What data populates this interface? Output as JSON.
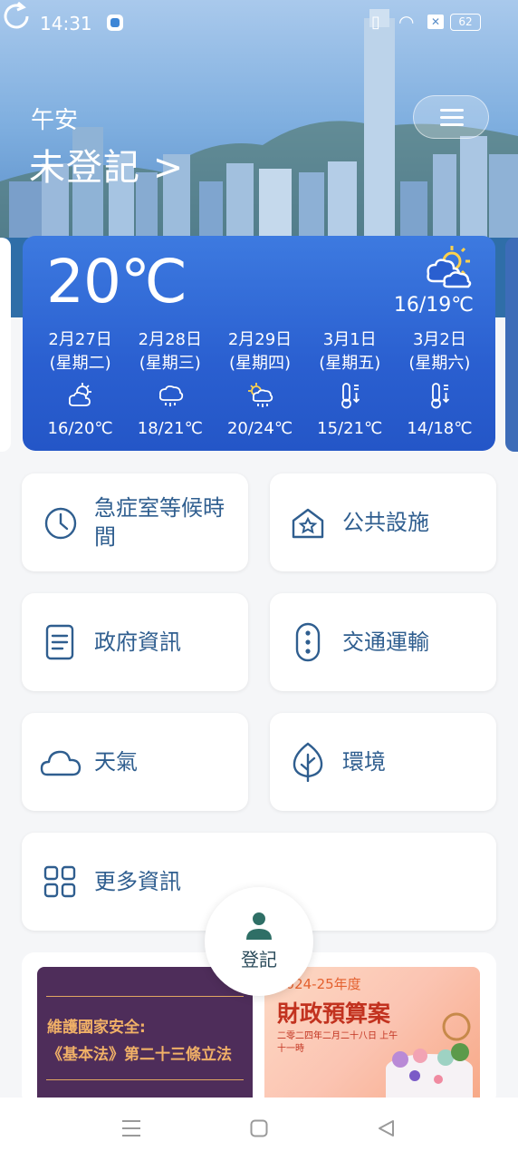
{
  "status": {
    "time": "14:31",
    "battery": "62"
  },
  "header": {
    "greeting": "午安",
    "login_link": "未登記 >"
  },
  "weather": {
    "current_temp": "20℃",
    "today_range": "16/19℃",
    "forecast": [
      {
        "date": "2月27日",
        "weekday": "(星期二)",
        "range": "16/20℃",
        "icon": "sun-cloud-icon"
      },
      {
        "date": "2月28日",
        "weekday": "(星期三)",
        "range": "18/21℃",
        "icon": "rain-cloud-icon"
      },
      {
        "date": "2月29日",
        "weekday": "(星期四)",
        "range": "20/24℃",
        "icon": "sun-rain-icon"
      },
      {
        "date": "3月1日",
        "weekday": "(星期五)",
        "range": "15/21℃",
        "icon": "temp-drop-icon"
      },
      {
        "date": "3月2日",
        "weekday": "(星期六)",
        "range": "14/18℃",
        "icon": "temp-drop-icon"
      }
    ]
  },
  "tiles": {
    "ae_wait": "急症室等候時間",
    "public_facilities": "公共設施",
    "gov_info": "政府資訊",
    "transport": "交通運輸",
    "weather": "天氣",
    "environment": "環境",
    "more_info": "更多資訊"
  },
  "fab": {
    "label": "登記"
  },
  "banners": {
    "security_line1": "維護國家安全:",
    "security_line2": "《基本法》第二十三條立法",
    "budget_year": "2024-25年度",
    "budget_title": "財政預算案",
    "budget_sub": "二零二四年二月二十八日 上午十一時"
  },
  "colors": {
    "accent": "#2f5e8f",
    "weather_card": "#2a5fd0"
  }
}
